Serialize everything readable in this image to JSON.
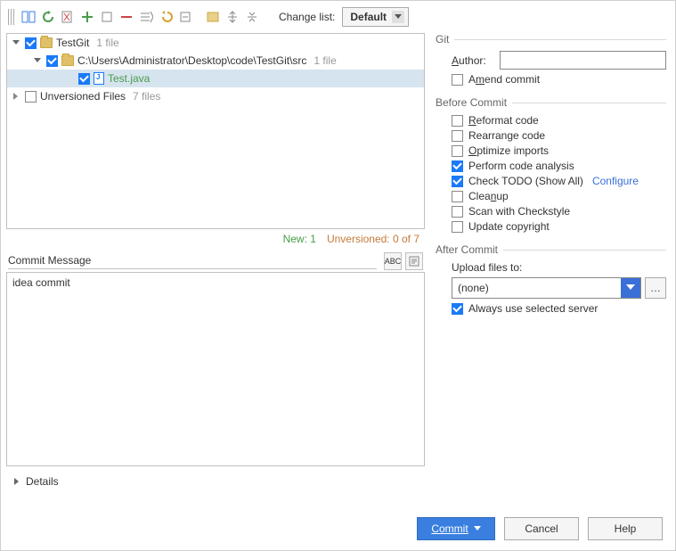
{
  "toolbar": {
    "change_list_label": "Change list:",
    "change_list_value": "Default"
  },
  "tree": {
    "root": {
      "name": "TestGit",
      "count": "1 file"
    },
    "path": {
      "name": "C:\\Users\\Administrator\\Desktop\\code\\TestGit\\src",
      "count": "1 file"
    },
    "file": {
      "name": "Test.java"
    },
    "unversioned": {
      "name": "Unversioned Files",
      "count": "7 files"
    }
  },
  "status": {
    "new": "New: 1",
    "unversioned": "Unversioned: 0 of 7"
  },
  "commit_message": {
    "label": "Commit Message",
    "text": "idea commit"
  },
  "details_label": "Details",
  "git": {
    "title": "Git",
    "author_label": "Author:",
    "author_value": "",
    "amend": "Amend commit"
  },
  "before": {
    "title": "Before Commit",
    "reformat": "Reformat code",
    "rearrange": "Rearrange code",
    "optimize": "Optimize imports",
    "analysis": "Perform code analysis",
    "todo": "Check TODO (Show All)",
    "configure": "Configure",
    "cleanup": "Cleanup",
    "checkstyle": "Scan with Checkstyle",
    "copyright": "Update copyright"
  },
  "after": {
    "title": "After Commit",
    "upload_label": "Upload files to:",
    "upload_value": "(none)",
    "always": "Always use selected server"
  },
  "buttons": {
    "commit": "Commit",
    "cancel": "Cancel",
    "help": "Help"
  },
  "checked": {
    "analysis": true,
    "todo": true,
    "always": true
  }
}
